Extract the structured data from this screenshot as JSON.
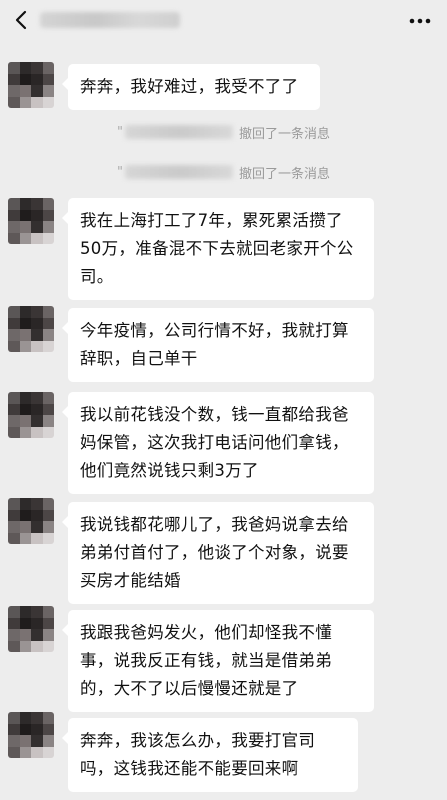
{
  "header": {
    "back_icon": "chevron-left-icon",
    "more_icon": "more-dots-icon"
  },
  "recall_notices": [
    {
      "quote": "\"",
      "text": "撤回了一条消息"
    },
    {
      "quote": "\"",
      "text": "撤回了一条消息"
    }
  ],
  "messages": [
    {
      "text": "奔奔，我好难过，我受不了了"
    },
    {
      "text": "我在上海打工了7年，累死累活攒了50万，准备混不下去就回老家开个公司。"
    },
    {
      "text": "今年疫情，公司行情不好，我就打算辞职，自己单干"
    },
    {
      "text": "我以前花钱没个数，钱一直都给我爸妈保管，这次我打电话问他们拿钱，他们竟然说钱只剩3万了"
    },
    {
      "text": "我说钱都花哪儿了，我爸妈说拿去给弟弟付首付了，他谈了个对象，说要买房才能结婚"
    },
    {
      "text": "我跟我爸妈发火，他们却怪我不懂事，说我反正有钱，就当是借弟弟的，大不了以后慢慢还就是了"
    },
    {
      "text": "奔奔，我该怎么办，我要打官司吗，这钱我还能不能要回来啊"
    }
  ],
  "colors": {
    "background": "#ededed",
    "bubble": "#ffffff",
    "recall_text": "#9a9a9a"
  }
}
